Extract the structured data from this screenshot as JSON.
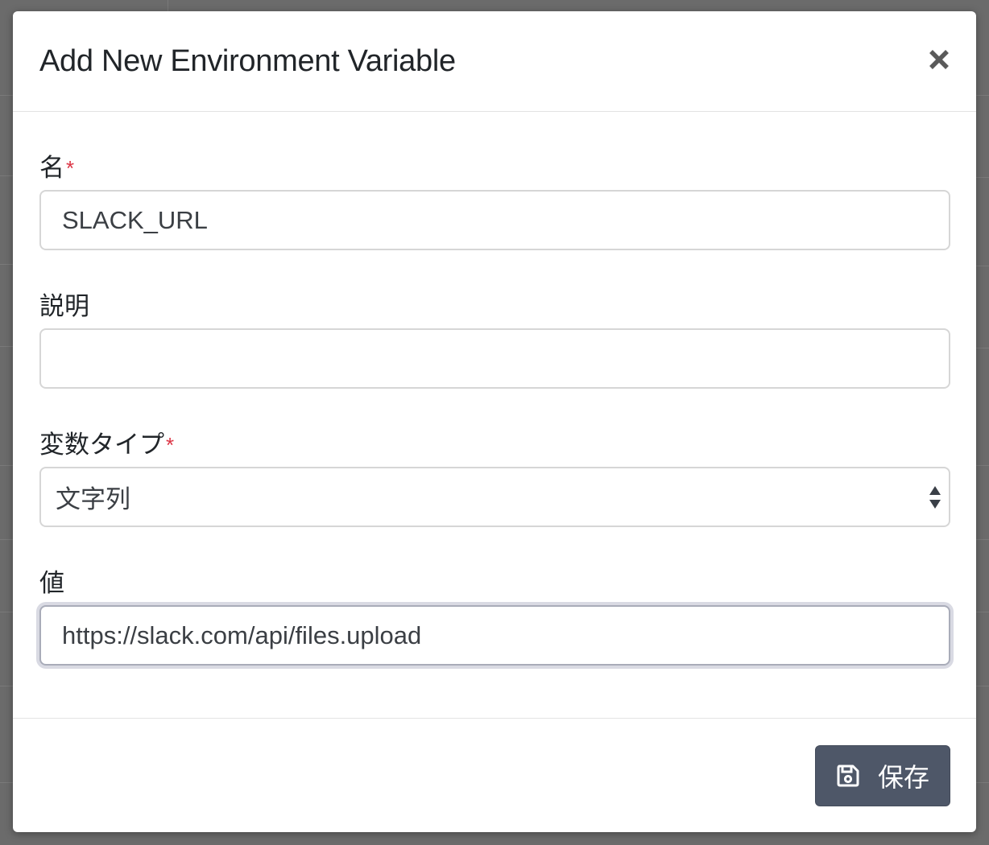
{
  "modal": {
    "title": "Add New Environment Variable"
  },
  "form": {
    "name": {
      "label": "名",
      "required_mark": "*",
      "value": "SLACK_URL"
    },
    "description": {
      "label": "説明",
      "value": ""
    },
    "variable_type": {
      "label": "変数タイプ",
      "required_mark": "*",
      "selected": "文字列"
    },
    "value": {
      "label": "値",
      "value": "https://slack.com/api/files.upload"
    }
  },
  "footer": {
    "save_label": "保存",
    "save_icon": "floppy-disk-icon"
  },
  "colors": {
    "required": "#dc3545",
    "primary_button": "#4e5768",
    "text": "#212529"
  }
}
